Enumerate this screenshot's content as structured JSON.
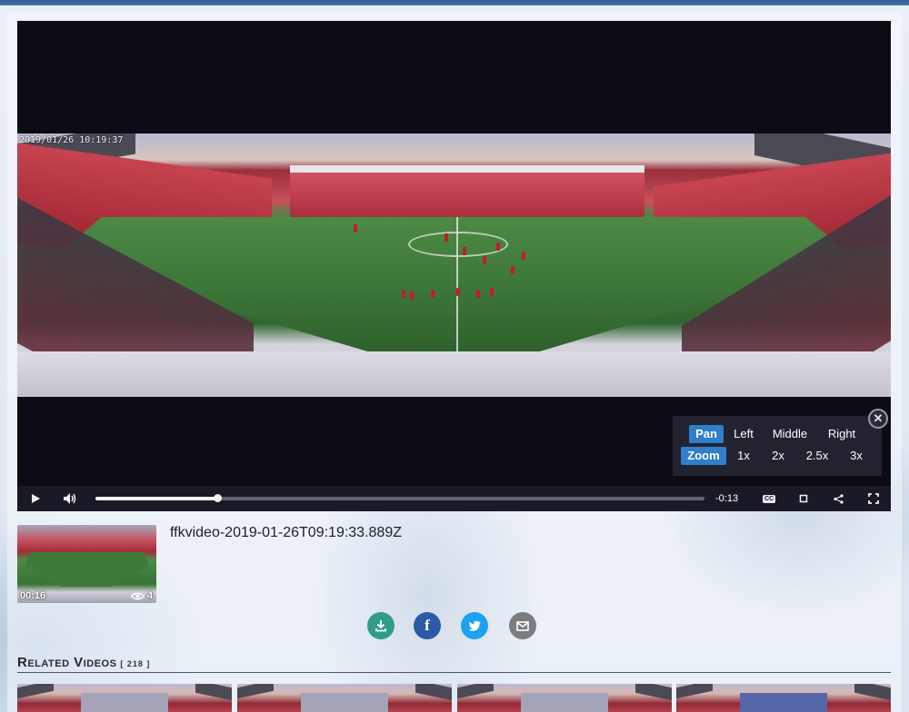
{
  "player": {
    "timestamp_overlay": "2019/01/26 10:19:37",
    "pan_zoom": {
      "pan_label": "Pan",
      "pan_options": [
        "Left",
        "Middle",
        "Right"
      ],
      "zoom_label": "Zoom",
      "zoom_options": [
        "1x",
        "2x",
        "2.5x",
        "3x"
      ]
    },
    "close_icon": "close-icon",
    "controls": {
      "play_icon": "play-icon",
      "volume_icon": "volume-icon",
      "progress": 0.2,
      "time_remaining": "-0:13",
      "captions_label": "CC",
      "pip_icon": "picture-in-picture-icon",
      "share_icon": "share-icon",
      "fullscreen_icon": "fullscreen-icon"
    }
  },
  "video": {
    "title": "ffkvideo-2019-01-26T09:19:33.889Z",
    "thumb_duration": "00:16",
    "thumb_views": "4"
  },
  "share": {
    "buttons": [
      {
        "name": "download",
        "icon": "download-icon",
        "color": "#2f9e86"
      },
      {
        "name": "facebook",
        "icon": "facebook-icon",
        "color": "#2d5aa6"
      },
      {
        "name": "twitter",
        "icon": "twitter-icon",
        "color": "#1da1f2"
      },
      {
        "name": "email",
        "icon": "email-icon",
        "color": "#7b7d80"
      }
    ]
  },
  "related": {
    "heading": "Related Videos",
    "count": "[ 218 ]"
  },
  "colors": {
    "accent": "#2f7fcb",
    "player_bg": "#0d0c14",
    "control_bar": "#1a1a26"
  }
}
